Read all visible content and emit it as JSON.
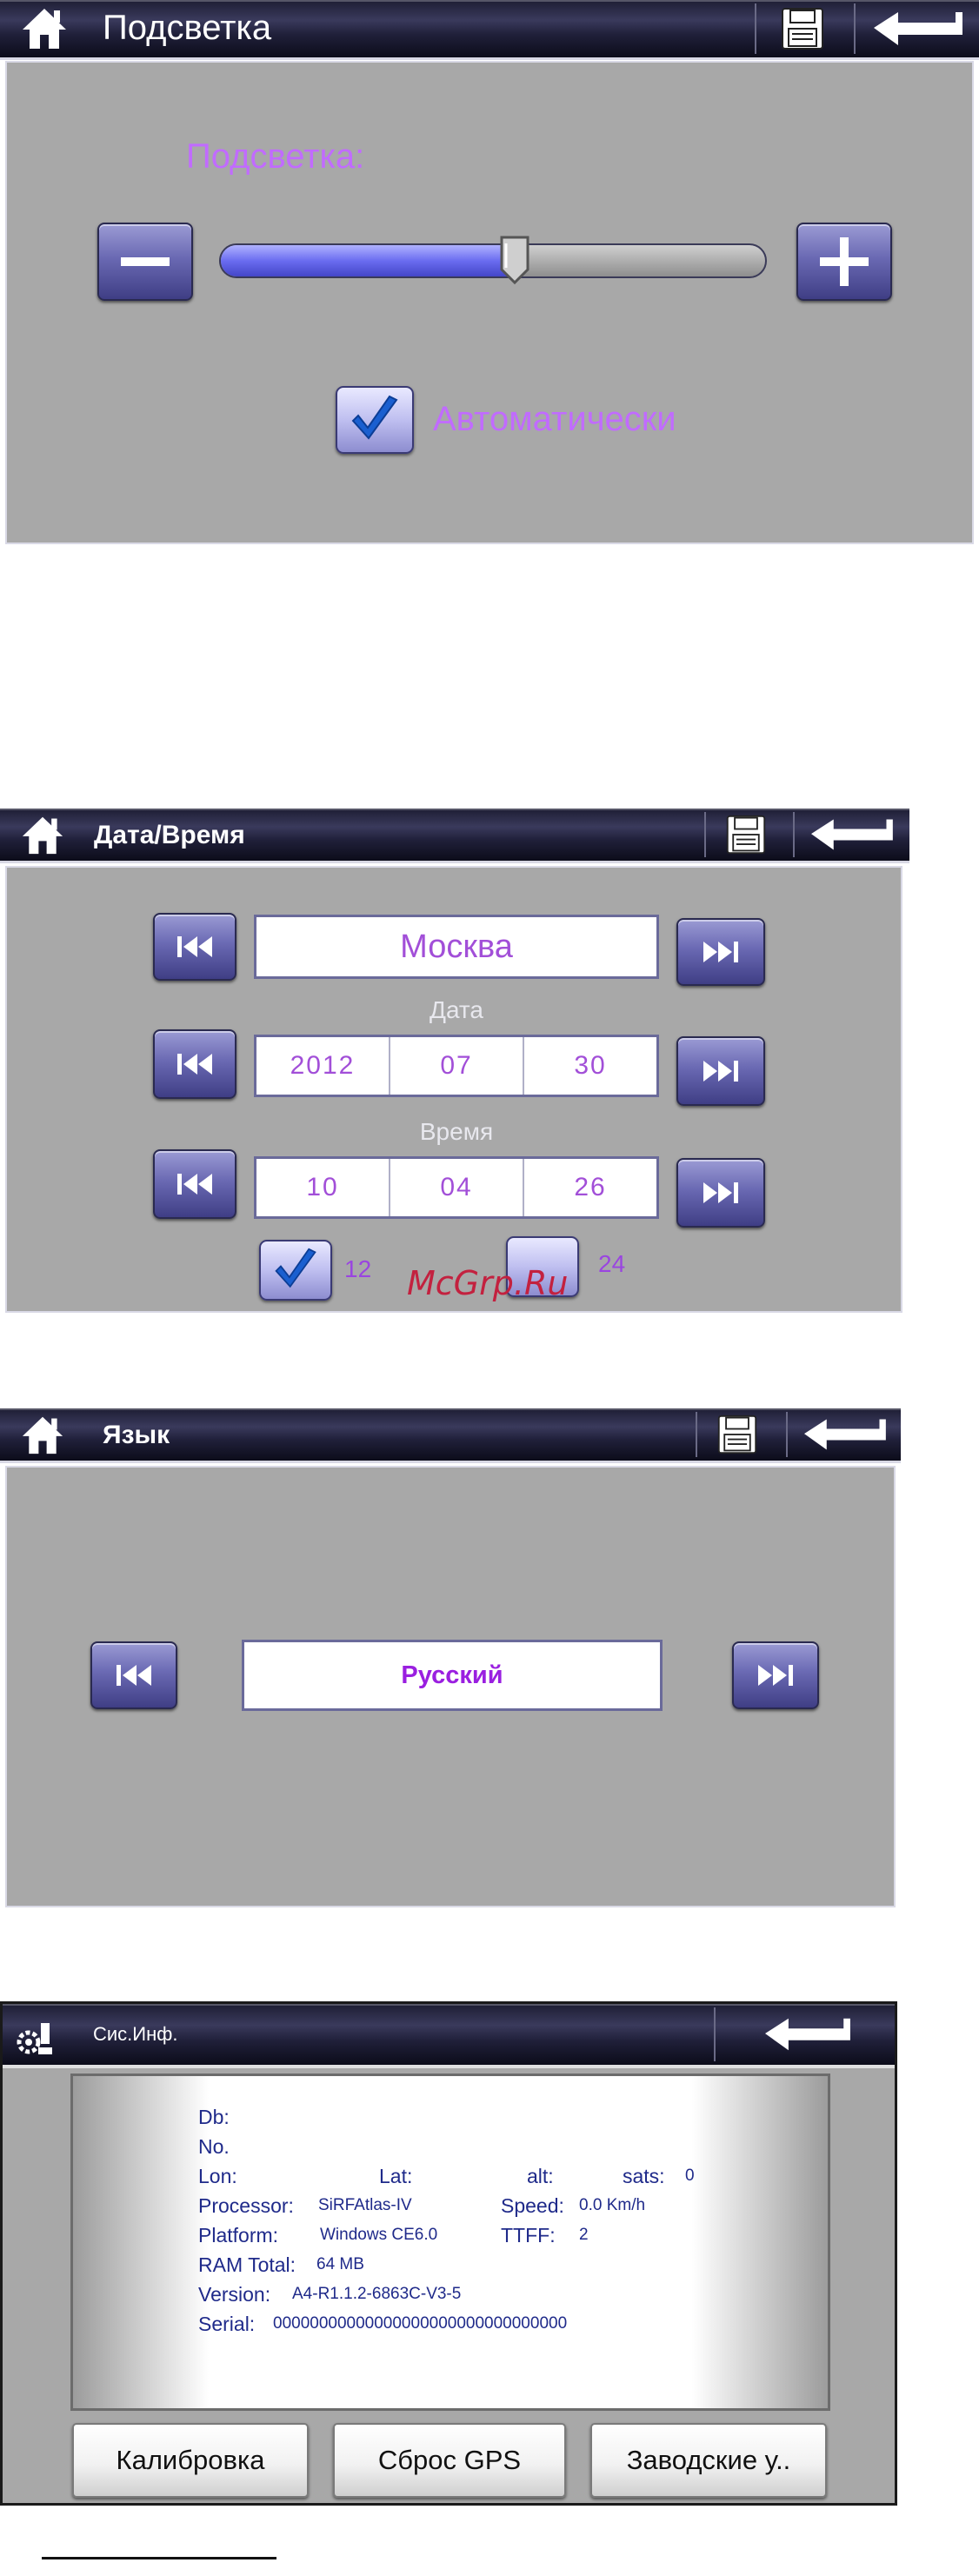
{
  "backlight": {
    "title": "Подсветка",
    "label": "Подсветка:",
    "level_fraction": 0.54,
    "auto_checked": true,
    "auto_label": "Автоматически"
  },
  "datetime": {
    "title": "Дата/Время",
    "city": "Москва",
    "date_label": "Дата",
    "date": [
      "2012",
      "07",
      "30"
    ],
    "time_label": "Время",
    "time": [
      "10",
      "04",
      "26"
    ],
    "format12_label": "12",
    "format12_checked": true,
    "format24_label": "24",
    "format24_checked": false
  },
  "language": {
    "title": "Язык",
    "value": "Русский"
  },
  "sysinfo": {
    "title": "Сис.Инф.",
    "db": "Db:",
    "no": "No.",
    "lon": "Lon:",
    "lat": "Lat:",
    "alt": "alt:",
    "sats_label": "sats:",
    "sats_value": "0",
    "processor_label": "Processor:",
    "processor_value": "SiRFAtlas-IV",
    "speed_label": "Speed:",
    "speed_value": "0.0 Km/h",
    "platform_label": "Platform:",
    "platform_value": "Windows CE6.0",
    "ttff_label": "TTFF:",
    "ttff_value": "2",
    "ram_label": "RAM Total:",
    "ram_value": "64 MB",
    "version_label": "Version:",
    "version_value": "A4-R1.1.2-6863C-V3-5",
    "serial_label": "Serial:",
    "serial_value": "00000000000000000000000000000000",
    "buttons": [
      "Калибровка",
      "Сброс GPS",
      "Заводские у.."
    ]
  },
  "watermark": "McGrp.Ru",
  "colors": {
    "accent": "#c16bff",
    "panel": "#a8a8a8",
    "button": "#5f5eae",
    "check": "#1a5fd0"
  }
}
